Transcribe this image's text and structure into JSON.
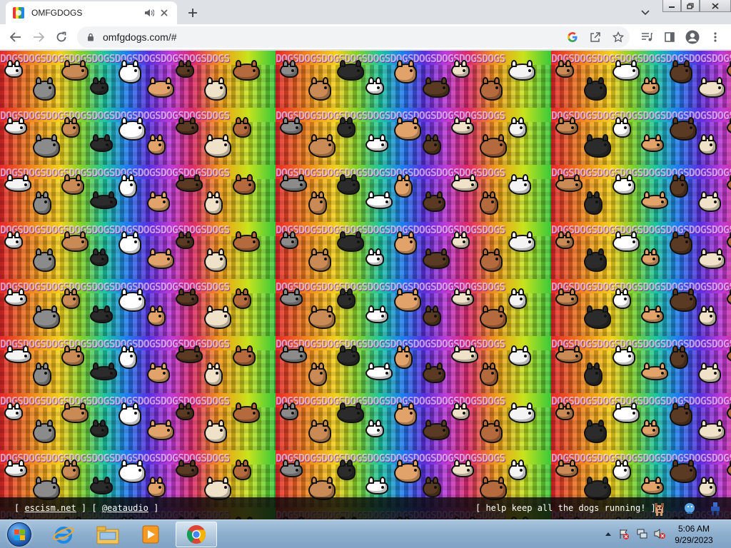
{
  "browser": {
    "tab_title": "OMFGDOGS",
    "url": "omfgdogs.com/#"
  },
  "page": {
    "tile_text": "DOGSDOGSDOGSDOGSDOGSDOGSDOGSDOGSDOGSDOGS",
    "credit_open": "[ ",
    "credit_link1": "escism.net",
    "credit_mid": " ] [ ",
    "credit_link2": "@eataudio",
    "credit_close": " ]",
    "help_text": "[ help keep all the dogs running! ]"
  },
  "taskbar": {
    "time": "5:06 AM",
    "date": "9/29/2023"
  },
  "colors": {
    "chrome_tabstrip": "#dee1e6",
    "omnibox": "#f1f3f4",
    "taskbar": "#8fb0cf"
  }
}
